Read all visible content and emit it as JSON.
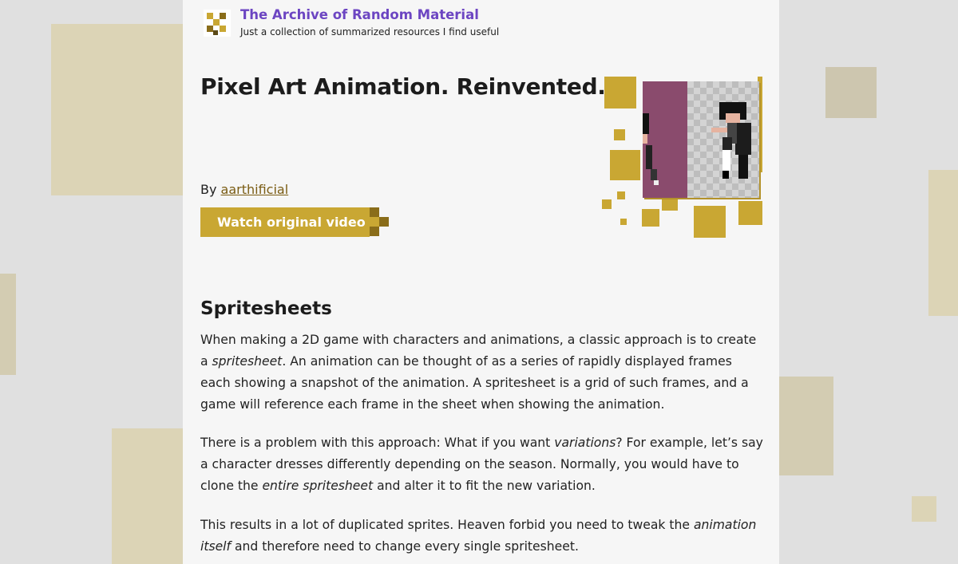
{
  "header": {
    "site_title": "The Archive of Random Material",
    "tagline": "Just a collection of summarized resources I find useful"
  },
  "post": {
    "title": "Pixel Art Animation. Reinvented.",
    "byline_prefix": "By",
    "author": "aarthificial",
    "watch_button": "Watch original video"
  },
  "section": {
    "heading": "Spritesheets",
    "paragraphs": [
      [
        {
          "t": "When making a 2D game with characters and animations, a classic approach is to create a "
        },
        {
          "t": "spritesheet",
          "em": true
        },
        {
          "t": ". An animation can be thought of as a series of rapidly displayed frames each showing a snapshot of the animation. A spritesheet is a grid of such frames, and a game will reference each frame in the sheet when showing the animation."
        }
      ],
      [
        {
          "t": "There is a problem with this approach: What if you want "
        },
        {
          "t": "variations",
          "em": true
        },
        {
          "t": "? For example, let’s say a character dresses differently depending on the season. Normally, you would have to clone the "
        },
        {
          "t": "entire spritesheet",
          "em": true
        },
        {
          "t": " and alter it to fit the new variation."
        }
      ],
      [
        {
          "t": "This results in a lot of duplicated sprites. Heaven forbid you need to tweak the "
        },
        {
          "t": "animation itself",
          "em": true
        },
        {
          "t": " and therefore need to change every single spritesheet."
        }
      ]
    ]
  },
  "colors": {
    "accent_gold": "#c9a733",
    "link_purple": "#6c45c2",
    "author_link": "#7a5c13",
    "page_bg": "#f6f6f6",
    "outer_bg": "#e0e0e0"
  },
  "icons": {
    "logo": "pixel-logo-icon",
    "button_decoration": "pixel-steps-icon",
    "hero_image": "pixel-sprite-illustration"
  }
}
